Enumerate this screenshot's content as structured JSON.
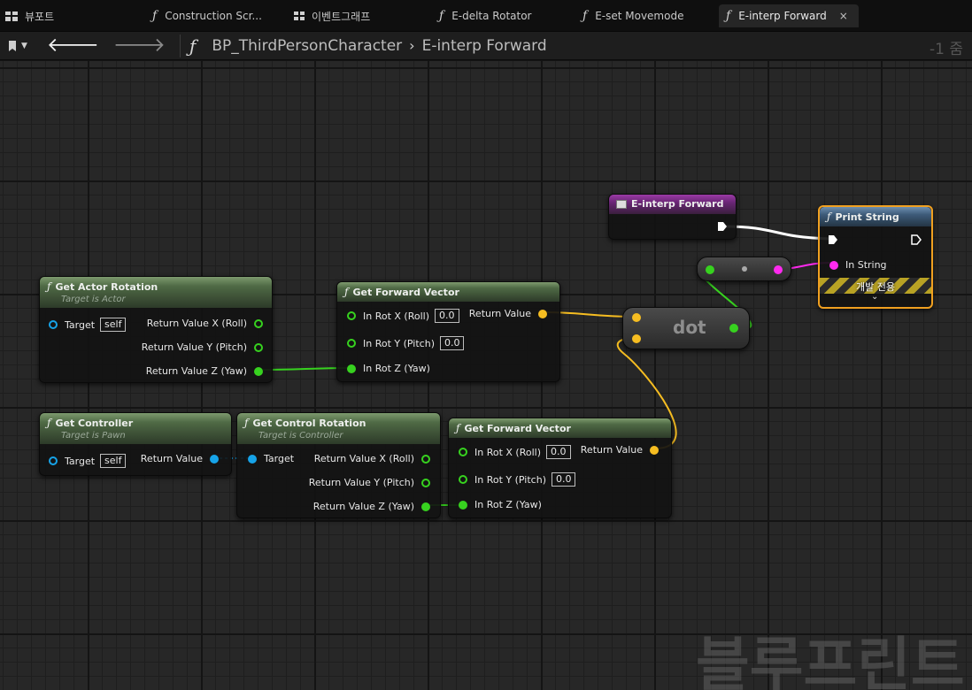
{
  "tabs": [
    {
      "label": "뷰포트",
      "icon": "grid-icon",
      "active": false
    },
    {
      "label": "Construction Scr...",
      "icon": "function-icon",
      "active": false
    },
    {
      "label": "이벤트그래프",
      "icon": "graph-icon",
      "active": false
    },
    {
      "label": "E-delta Rotator",
      "icon": "function-icon",
      "active": false
    },
    {
      "label": "E-set Movemode",
      "icon": "function-icon",
      "active": false
    },
    {
      "label": "E-interp Forward",
      "icon": "function-icon",
      "active": true,
      "close": "×"
    }
  ],
  "breadcrumb": {
    "items": [
      "BP_ThirdPersonCharacter",
      "E-interp Forward"
    ],
    "separator": "›",
    "zoom": "-1 줌"
  },
  "nodes": {
    "entry": {
      "title": "E-interp Forward"
    },
    "print": {
      "title": "Print String",
      "in_string": "In String",
      "dev_only": "개발 전용"
    },
    "actor_rot": {
      "title": "Get Actor Rotation",
      "subtitle": "Target is Actor",
      "target": "Target",
      "target_val": "self",
      "out_x": "Return Value X (Roll)",
      "out_y": "Return Value Y (Pitch)",
      "out_z": "Return Value Z (Yaw)"
    },
    "fwd1": {
      "title": "Get Forward Vector",
      "in_x": "In Rot X (Roll)",
      "in_x_val": "0.0",
      "in_y": "In Rot Y (Pitch)",
      "in_y_val": "0.0",
      "in_z": "In Rot Z (Yaw)",
      "out": "Return Value"
    },
    "controller": {
      "title": "Get Controller",
      "subtitle": "Target is Pawn",
      "target": "Target",
      "target_val": "self",
      "out": "Return Value"
    },
    "ctrl_rot": {
      "title": "Get Control Rotation",
      "subtitle": "Target is Controller",
      "target": "Target",
      "out_x": "Return Value X (Roll)",
      "out_y": "Return Value Y (Pitch)",
      "out_z": "Return Value Z (Yaw)"
    },
    "fwd2": {
      "title": "Get Forward Vector",
      "in_x": "In Rot X (Roll)",
      "in_x_val": "0.0",
      "in_y": "In Rot Y (Pitch)",
      "in_y_val": "0.0",
      "in_z": "In Rot Z (Yaw)",
      "out": "Return Value"
    },
    "dot": {
      "label": "dot"
    }
  },
  "watermark": "블루프린트",
  "colors": {
    "float_pin": "#37d21f",
    "vector_pin": "#f6bd21",
    "object_pin": "#16a3e8",
    "string_pin": "#ff2aef",
    "exec_wire": "#ffffff",
    "entry_header": "#7a2a8a",
    "print_border": "#f0a020"
  }
}
